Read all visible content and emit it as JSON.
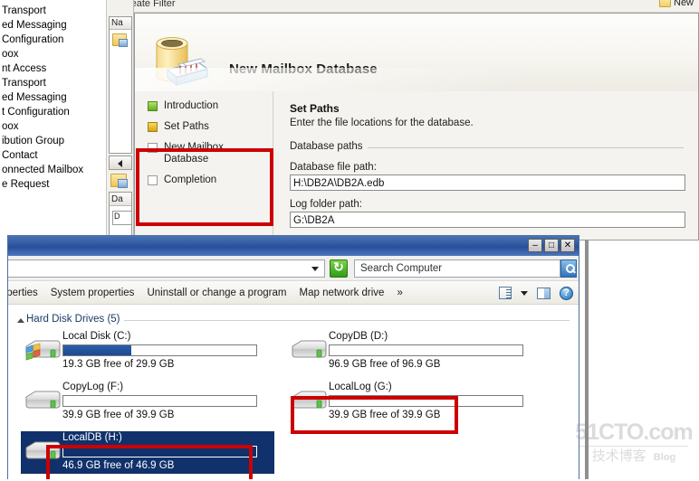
{
  "console": {
    "create_filter_label": "Create Filter",
    "new_action_label": "New",
    "tree_items": [
      "Transport",
      "ed Messaging",
      "Configuration",
      "oox",
      "nt Access",
      "Transport",
      "ed Messaging",
      "t Configuration",
      "oox",
      "ibution Group",
      "Contact",
      "onnected Mailbox",
      "e Request"
    ],
    "result_column_header": "Na",
    "details_column_header": "Da",
    "details_cell": "D"
  },
  "wizard": {
    "title": "New Mailbox Database",
    "steps": [
      {
        "label": "Introduction",
        "state": "done"
      },
      {
        "label": "Set Paths",
        "state": "current"
      },
      {
        "label": "New Mailbox Database",
        "state": "pending"
      },
      {
        "label": "Completion",
        "state": "pending"
      }
    ],
    "pane_title": "Set Paths",
    "pane_subtitle": "Enter the file locations for the database.",
    "group_label": "Database paths",
    "database_file_path_label": "Database file path:",
    "database_file_path_value": "H:\\DB2A\\DB2A.edb",
    "log_folder_path_label": "Log folder path:",
    "log_folder_path_value": "G:\\DB2A"
  },
  "explorer": {
    "address_value": "",
    "search_placeholder": "Search Computer",
    "refresh_tooltip": "refresh-icon",
    "toolbar_items": [
      "roperties",
      "System properties",
      "Uninstall or change a program",
      "Map network drive",
      "»"
    ],
    "window_buttons": {
      "minimize": "–",
      "maximize": "□",
      "close": "✕"
    },
    "group_title": "Hard Disk Drives (5)",
    "drives": [
      {
        "name": "Local Disk (C:)",
        "free_text": "19.3 GB free of 29.9 GB",
        "used_percent": 35,
        "selected": false,
        "highlighted": false,
        "system": true
      },
      {
        "name": "CopyDB (D:)",
        "free_text": "96.9 GB free of 96.9 GB",
        "used_percent": 0,
        "selected": false,
        "highlighted": false,
        "system": false
      },
      {
        "name": "CopyLog (F:)",
        "free_text": "39.9 GB free of 39.9 GB",
        "used_percent": 0,
        "selected": false,
        "highlighted": false,
        "system": false
      },
      {
        "name": "LocalLog (G:)",
        "free_text": "39.9 GB free of 39.9 GB",
        "used_percent": 0,
        "selected": false,
        "highlighted": true,
        "system": false
      },
      {
        "name": "LocalDB (H:)",
        "free_text": "46.9 GB free of 46.9 GB",
        "used_percent": 0,
        "selected": true,
        "highlighted": true,
        "system": false
      }
    ]
  },
  "watermark": {
    "main": "51CTO.com",
    "sub": "技术博客",
    "blog": "Blog"
  },
  "colors": {
    "annotation_red": "#cc0000",
    "selection_blue": "#10316b",
    "titlebar_blue": "#2f57a0",
    "usage_bar_blue": "#2b5fa8"
  }
}
